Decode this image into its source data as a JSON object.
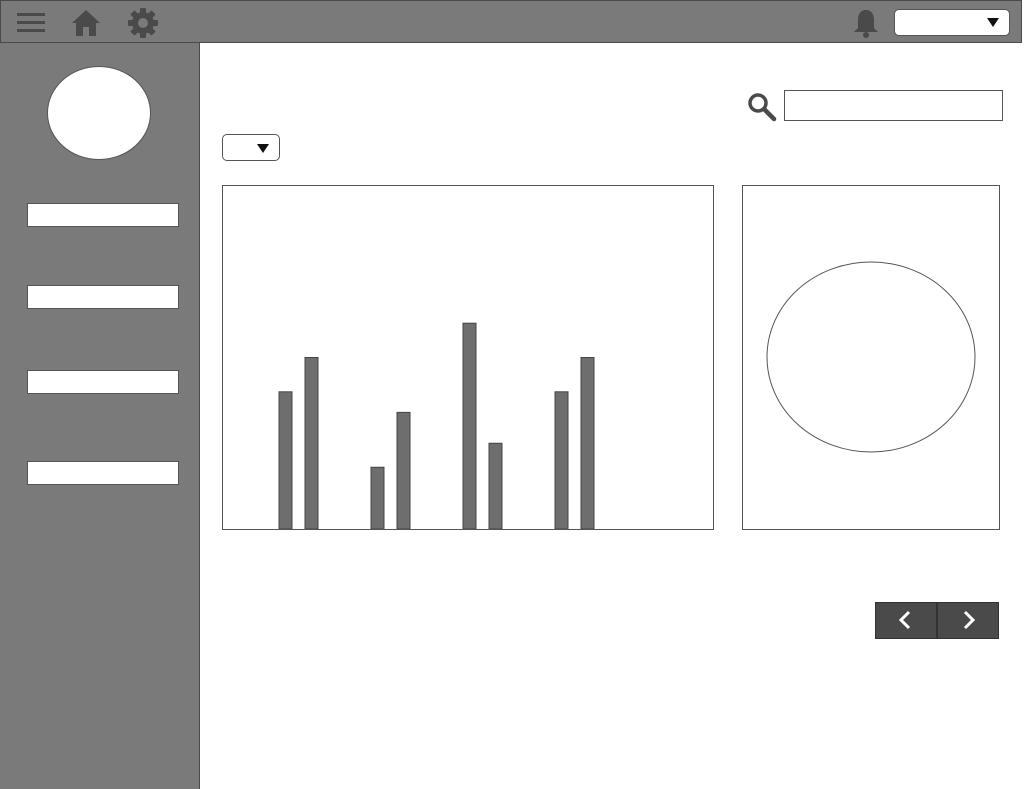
{
  "topbar": {
    "icons": [
      "menu-icon",
      "home-icon",
      "settings-icon",
      "bell-icon"
    ],
    "user_select_value": ""
  },
  "sidebar": {
    "items": [
      {
        "label": ""
      },
      {
        "label": ""
      },
      {
        "label": ""
      },
      {
        "label": ""
      }
    ]
  },
  "search": {
    "placeholder": "",
    "value": ""
  },
  "filter": {
    "value": ""
  },
  "colors": {
    "chrome": "#7a7a7a",
    "bar_fill": "#6e6e6e",
    "button_dark": "#4a4a4a"
  },
  "chart_data": {
    "type": "bar",
    "categories": [
      "",
      "",
      "",
      ""
    ],
    "series": [
      {
        "values": [
          40,
          18,
          60,
          40
        ]
      },
      {
        "values": [
          50,
          34,
          25,
          50
        ]
      }
    ],
    "ylim": [
      0,
      100
    ],
    "grid": false
  },
  "pie": {
    "type": "pie",
    "values": []
  },
  "pager": {
    "prev_icon": "chevron-left-icon",
    "next_icon": "chevron-right-icon"
  }
}
